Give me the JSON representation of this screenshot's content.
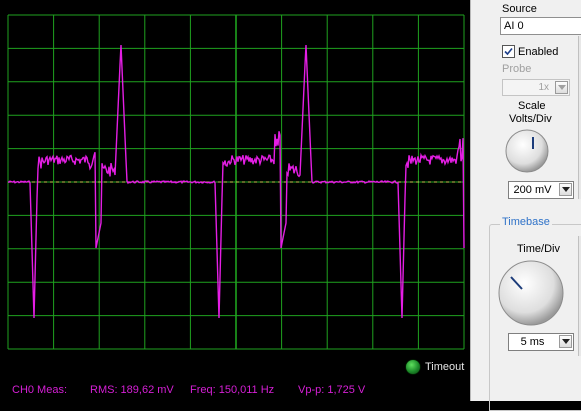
{
  "measurements": {
    "channel": "CH0 Meas:",
    "rms": "RMS:  189,62 mV",
    "freq": "Freq:  150,011 Hz",
    "vpp": "Vp-p:  1,725 V"
  },
  "status": {
    "timeout_label": "Timeout",
    "led_color": "#2fb63b"
  },
  "panel": {
    "source_label": "Source",
    "source_value": "AI 0",
    "enabled_label": "Enabled",
    "enabled_checked": true,
    "probe_label": "Probe",
    "probe_value": "1x",
    "scale_label": "Scale",
    "volts_div_label": "Volts/Div",
    "volts_div_value": "200 mV",
    "timebase_label": "Timebase",
    "time_div_label": "Time/Div",
    "time_div_value": "5 ms"
  },
  "colors": {
    "grid": "#1fa21f",
    "trace": "#e41ee4",
    "background": "#000000",
    "accent": "#2f72c8"
  },
  "icons": [
    "checkbox-check-icon",
    "chevron-down-icon",
    "knob-icon",
    "status-led-icon"
  ]
}
